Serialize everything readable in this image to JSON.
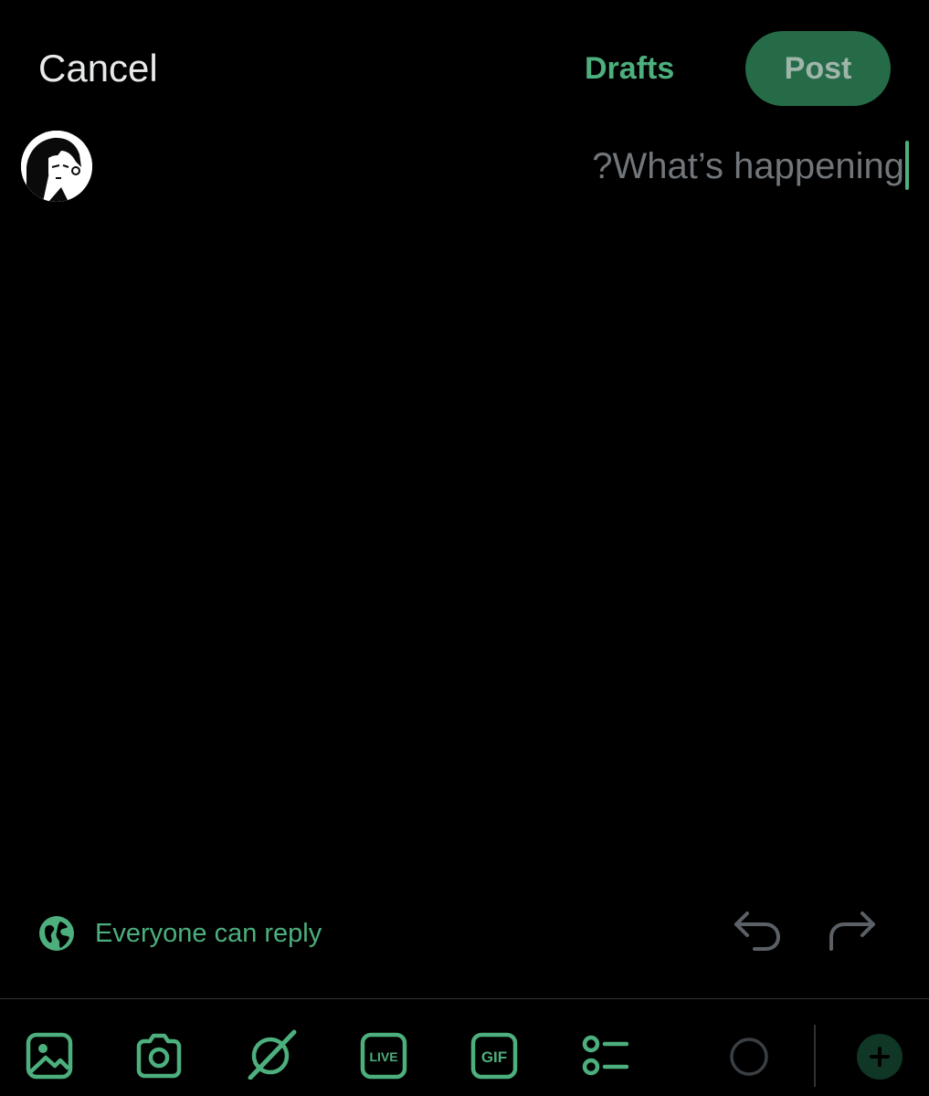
{
  "header": {
    "cancel_label": "Cancel",
    "drafts_label": "Drafts",
    "post_label": "Post"
  },
  "compose": {
    "placeholder": "?What’s happening"
  },
  "reply_settings": {
    "label": "Everyone can reply",
    "icon": "globe-icon"
  },
  "toolbar": {
    "items": [
      {
        "icon": "image-icon"
      },
      {
        "icon": "camera-icon"
      },
      {
        "icon": "grok-icon"
      },
      {
        "icon": "live-icon",
        "label": "LIVE"
      },
      {
        "icon": "gif-icon",
        "label": "GIF"
      },
      {
        "icon": "poll-icon"
      },
      {
        "icon": "character-count-ring-icon"
      },
      {
        "icon": "add-post-icon"
      }
    ]
  },
  "colors": {
    "accent": "#4caf7d",
    "post_button_bg": "#256b48",
    "placeholder": "#71767b",
    "background": "#000000"
  }
}
